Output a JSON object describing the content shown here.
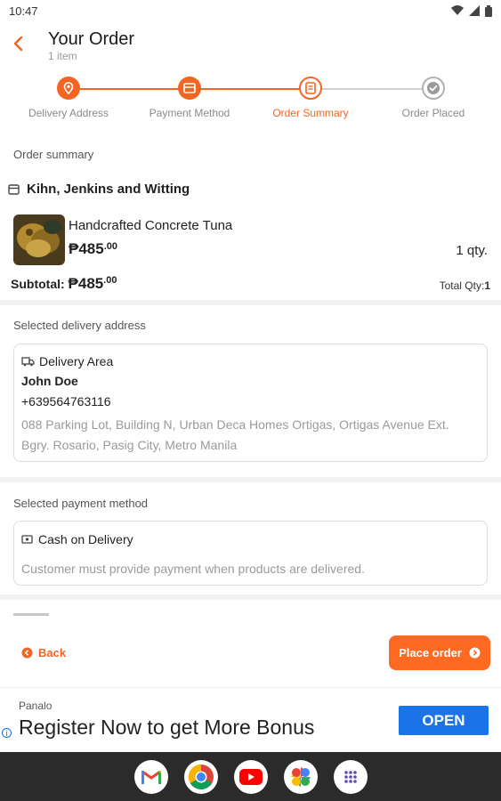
{
  "status_bar": {
    "time": "10:47"
  },
  "header": {
    "title": "Your Order",
    "subtitle": "1 item"
  },
  "stepper": {
    "steps": [
      {
        "label": "Delivery Address",
        "state": "done",
        "icon": "location-pin-icon"
      },
      {
        "label": "Payment Method",
        "state": "done",
        "icon": "card-icon"
      },
      {
        "label": "Order Summary",
        "state": "active",
        "icon": "receipt-icon"
      },
      {
        "label": "Order Placed",
        "state": "pending",
        "icon": "check-circle-icon"
      }
    ],
    "accent_color": "#f26522",
    "pending_color": "#a9a9a9"
  },
  "order_summary": {
    "section_title": "Order summary",
    "store_name": "Kihn, Jenkins and Witting",
    "product": {
      "name": "Handcrafted Concrete Tuna",
      "price_main": "₱485",
      "price_cents": ".00",
      "qty": "1 qty."
    },
    "subtotal_label": "Subtotal:",
    "subtotal_main": "₱485",
    "subtotal_cents": ".00",
    "total_qty_label": "Total Qty:",
    "total_qty_value": "1"
  },
  "delivery": {
    "section_title": "Selected delivery address",
    "area_label": "Delivery Area",
    "name": "John Doe",
    "phone": "+639564763116",
    "address_line1": "088 Parking Lot, Building N, Urban Deca Homes Ortigas, Ortigas Avenue Ext.",
    "address_line2": "Bgry. Rosario, Pasig City, Metro Manila"
  },
  "payment": {
    "section_title": "Selected payment method",
    "method": "Cash on Delivery",
    "description": "Customer must provide payment when products are delivered."
  },
  "footer": {
    "back_label": "Back",
    "place_order_label": "Place order"
  },
  "ad": {
    "brand": "Panalo",
    "headline": "Register Now to get More Bonus",
    "cta": "OPEN",
    "cta_color": "#1a73e8"
  },
  "dock": {
    "apps": [
      "gmail-icon",
      "chrome-icon",
      "youtube-icon",
      "photos-icon",
      "apps-grid-icon"
    ]
  }
}
